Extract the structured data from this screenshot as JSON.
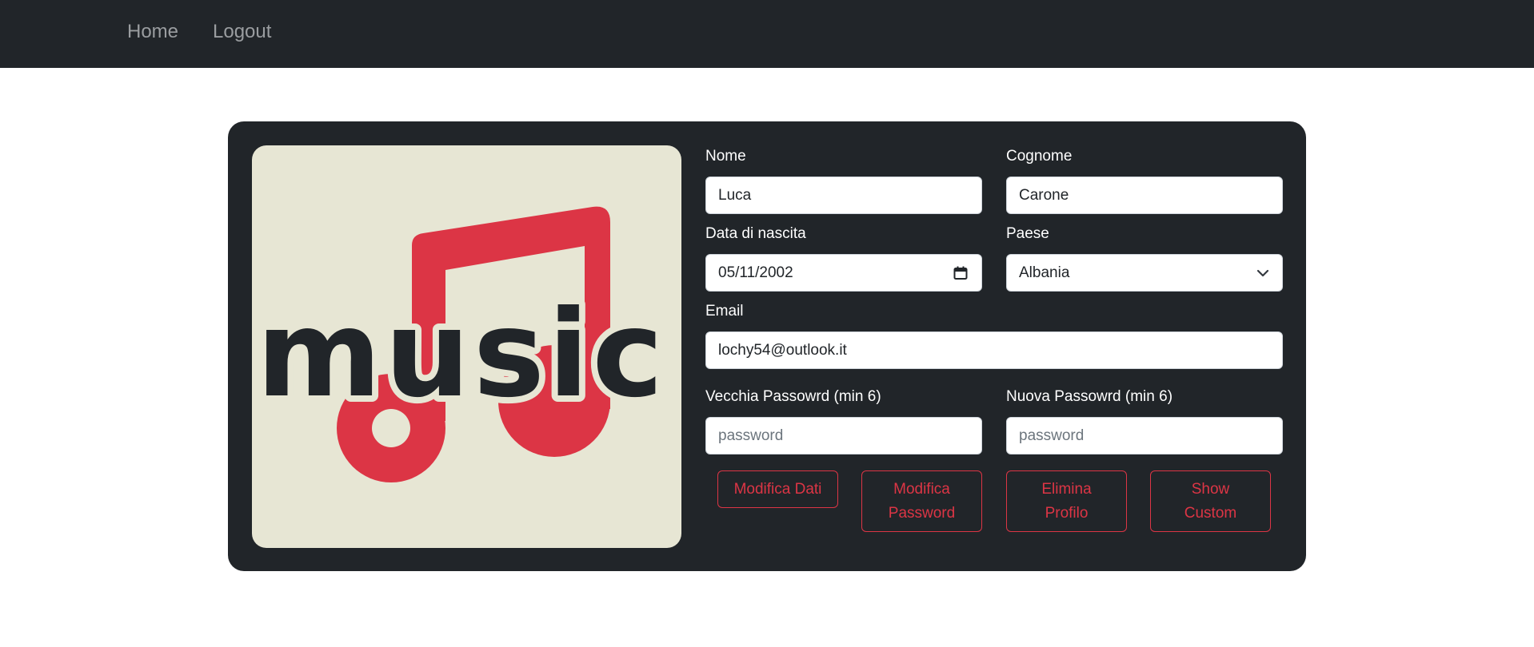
{
  "nav": {
    "home_label": "Home",
    "logout_label": "Logout"
  },
  "logo": {
    "text": "music",
    "note_color": "#dc3545",
    "text_color": "#212529",
    "background_color": "#e7e6d4"
  },
  "form": {
    "nome": {
      "label": "Nome",
      "value": "Luca"
    },
    "cognome": {
      "label": "Cognome",
      "value": "Carone"
    },
    "data_nascita": {
      "label": "Data di nascita",
      "value": "05/11/2002",
      "icon": "calendar-icon"
    },
    "paese": {
      "label": "Paese",
      "value": "Albania",
      "icon": "chevron-down-icon"
    },
    "email": {
      "label": "Email",
      "value": "lochy54@outlook.it"
    },
    "vecchia_password": {
      "label": "Vecchia Passowrd (min 6)",
      "placeholder": "password"
    },
    "nuova_password": {
      "label": "Nuova Passowrd (min 6)",
      "placeholder": "password"
    }
  },
  "buttons": {
    "modifica_dati": "Modifica Dati",
    "modifica_password_line1": "Modifica",
    "modifica_password_line2": "Password",
    "elimina_profilo_line1": "Elimina",
    "elimina_profilo_line2": "Profilo",
    "show_custom_line1": "Show",
    "show_custom_line2": "Custom"
  },
  "colors": {
    "navbar_bg": "#212529",
    "card_bg": "#212529",
    "accent_danger": "#dc3545"
  }
}
